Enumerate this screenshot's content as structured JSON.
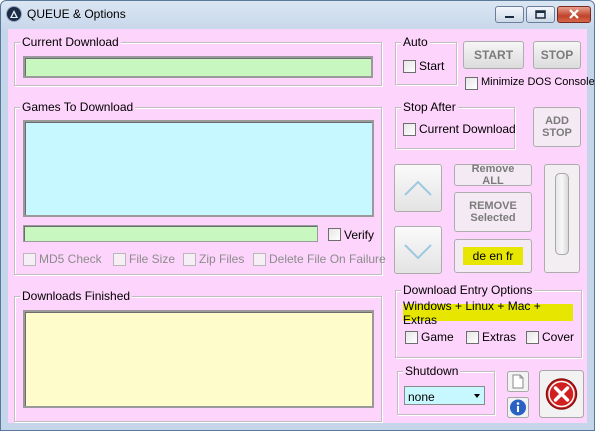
{
  "window": {
    "title": "QUEUE & Options"
  },
  "current_download": {
    "label": "Current Download",
    "value": ""
  },
  "auto": {
    "label": "Auto",
    "start_label": "Start",
    "start_checked": false
  },
  "buttons": {
    "start": "START",
    "stop": "STOP",
    "add_stop": "ADD\nSTOP",
    "remove_all": "Remove ALL",
    "remove_selected": "REMOVE\nSelected"
  },
  "minimize_dos": {
    "label": "Minimize DOS Console",
    "checked": false
  },
  "stop_after": {
    "label": "Stop After",
    "current_download_label": "Current Download",
    "checked": false
  },
  "games_to_download": {
    "label": "Games To Download",
    "items": []
  },
  "verify": {
    "label": "Verify",
    "checked": false
  },
  "options": {
    "md5": "MD5 Check",
    "file_size": "File Size",
    "zip_files": "Zip Files",
    "delete_on_failure": "Delete File On Failure"
  },
  "languages": "de en fr",
  "downloads_finished": {
    "label": "Downloads Finished",
    "items": []
  },
  "download_entry_options": {
    "label": "Download Entry Options",
    "platforms": "Windows + Linux + Mac + Extras",
    "game": "Game",
    "extras": "Extras",
    "cover": "Cover"
  },
  "shutdown": {
    "label": "Shutdown",
    "value": "none"
  },
  "colors": {
    "current_field": "#c8f7c0",
    "games_list": "#c8f8ff",
    "finished_list": "#fffccc",
    "client_bg": "#fdd4fb",
    "badge": "#e6e600"
  },
  "icons": [
    "app-icon",
    "minimize-icon",
    "maximize-icon",
    "close-icon",
    "arrow-up-icon",
    "arrow-down-icon",
    "document-icon",
    "info-icon",
    "exit-icon"
  ]
}
